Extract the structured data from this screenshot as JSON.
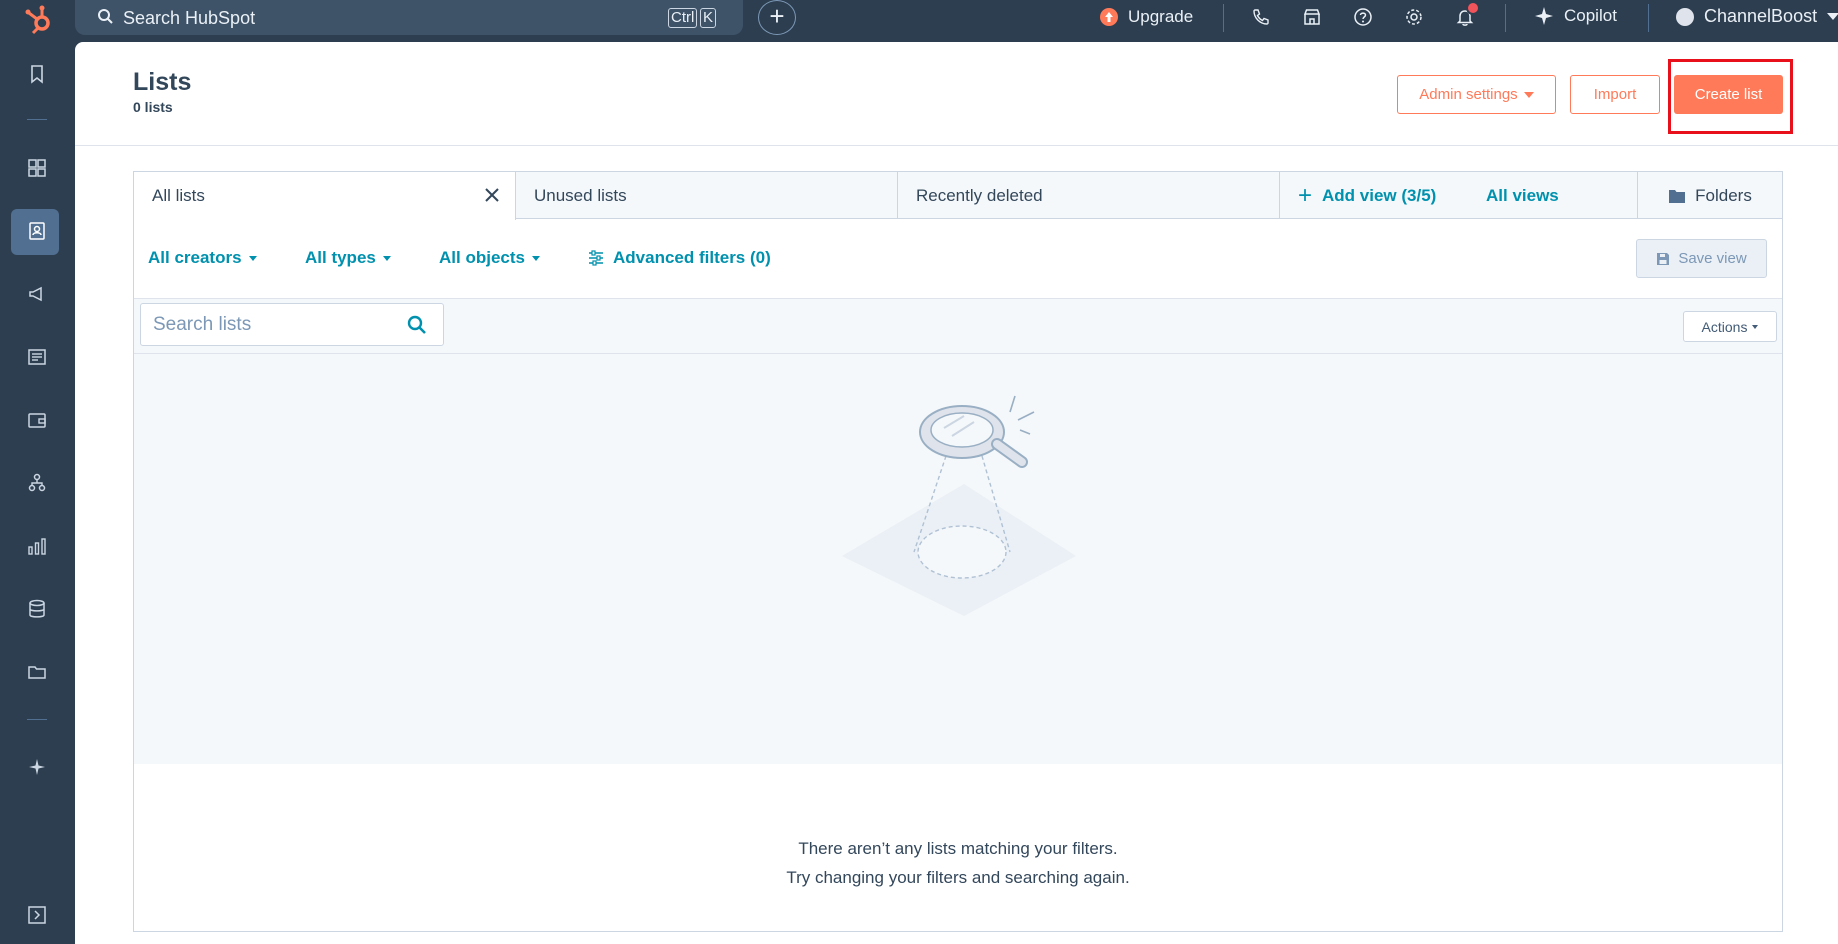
{
  "topbar": {
    "search_placeholder": "Search HubSpot",
    "kbd_ctrl": "Ctrl",
    "kbd_k": "K",
    "add": "+",
    "upgrade": "Upgrade",
    "copilot": "Copilot",
    "account": "ChannelBoost"
  },
  "page": {
    "title": "Lists",
    "count": "0 lists"
  },
  "header_buttons": {
    "admin": "Admin settings",
    "import": "Import",
    "create": "Create list"
  },
  "tabs": [
    {
      "label": "All lists"
    },
    {
      "label": "Unused lists"
    },
    {
      "label": "Recently deleted"
    }
  ],
  "tab_actions": {
    "add_view": "Add view (3/5)",
    "all_views": "All views",
    "folders": "Folders"
  },
  "filters": {
    "creators": "All creators",
    "types": "All types",
    "objects": "All objects",
    "advanced": "Advanced filters (0)",
    "save_view": "Save view"
  },
  "toolbar": {
    "search_placeholder": "Search lists",
    "actions": "Actions"
  },
  "empty_state": {
    "line1": "There aren’t any lists matching your filters.",
    "line2": "Try changing your filters and searching again."
  },
  "colors": {
    "accent": "#ff7a59",
    "link": "#0091ae",
    "nav": "#2d3e50",
    "highlight": "#e8101a"
  }
}
